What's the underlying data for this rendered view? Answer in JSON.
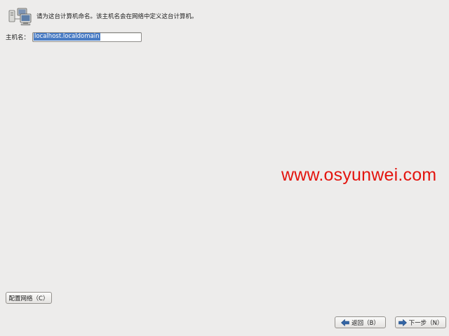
{
  "header": {
    "icon": "network-computers-icon",
    "text": "请为这台计算机命名。该主机名会在网络中定义这台计算机。"
  },
  "hostname": {
    "label": "主机名：",
    "value": "localhost.localdomain"
  },
  "watermark": "www.osyunwei.com",
  "buttons": {
    "configure_network": "配置网络（C）",
    "back": "返回（B）",
    "next": "下一步（N）"
  },
  "colors": {
    "background": "#edeceb",
    "selection": "#4a7cc4",
    "watermark": "#e3140e",
    "arrow": "#3465a4"
  }
}
